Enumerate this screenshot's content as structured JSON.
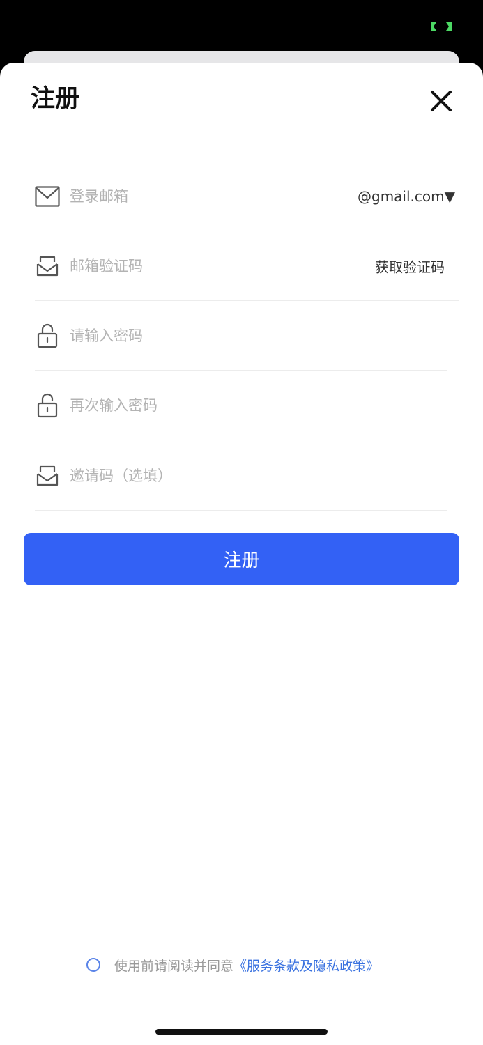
{
  "header": {
    "title": "注册"
  },
  "form": {
    "email": {
      "placeholder": "登录邮箱",
      "domain_suffix": "@gmail.com▼"
    },
    "email_code": {
      "placeholder": "邮箱验证码",
      "get_code_label": "获取验证码"
    },
    "password": {
      "placeholder": "请输入密码"
    },
    "password_confirm": {
      "placeholder": "再次输入密码"
    },
    "invite_code": {
      "placeholder": "邀请码（选填）"
    },
    "submit_label": "注册"
  },
  "agreement": {
    "text": "使用前请阅读并同意",
    "link": "《服务条款及隐私政策》"
  },
  "colors": {
    "primary": "#3361f5",
    "link": "#3a72e0",
    "status_indicator": "#4cd964"
  },
  "icons": {
    "close": "close-icon",
    "email": "mail-icon",
    "email_code": "inbox-icon",
    "password": "lock-icon",
    "invite": "inbox-icon"
  }
}
